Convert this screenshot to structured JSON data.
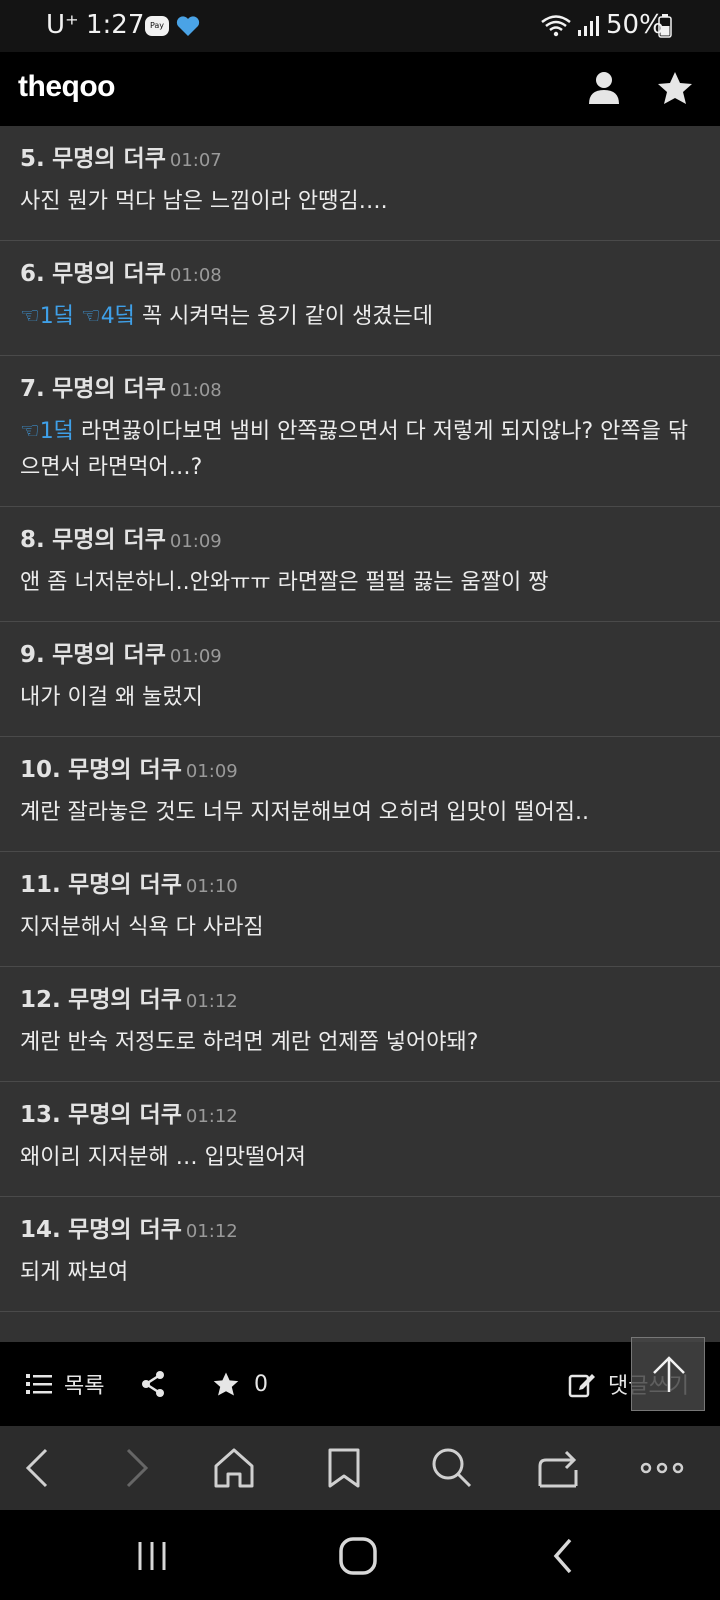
{
  "status_bar": {
    "carrier": "U⁺",
    "time": "1:27",
    "pay_badge": "Pay",
    "battery": "50%"
  },
  "app": {
    "title": "theqoo"
  },
  "comments": [
    {
      "num": "5.",
      "author": "무명의 더쿠",
      "time": "01:07",
      "mentions": [],
      "text": "사진 뭔가 먹다 남은 느낌이라 안땡김…."
    },
    {
      "num": "6.",
      "author": "무명의 더쿠",
      "time": "01:08",
      "mentions": [
        "☜1덬",
        "☜4덬"
      ],
      "text": "꼭 시켜먹는 용기 같이 생겼는데"
    },
    {
      "num": "7.",
      "author": "무명의 더쿠",
      "time": "01:08",
      "mentions": [
        "☜1덬"
      ],
      "text": "라면끓이다보면 냄비 안쪽끓으면서 다 저렇게 되지않나? 안쪽을 닦으면서 라면먹어…?"
    },
    {
      "num": "8.",
      "author": "무명의 더쿠",
      "time": "01:09",
      "mentions": [],
      "text": "앤 좀 너저분하니..안와ㅠㅠ 라면짤은 펄펄 끓는 움짤이 짱"
    },
    {
      "num": "9.",
      "author": "무명의 더쿠",
      "time": "01:09",
      "mentions": [],
      "text": "내가 이걸 왜 눌렀지"
    },
    {
      "num": "10.",
      "author": "무명의 더쿠",
      "time": "01:09",
      "mentions": [],
      "text": "계란 잘라놓은 것도 너무 지저분해보여 오히려 입맛이 떨어짐.."
    },
    {
      "num": "11.",
      "author": "무명의 더쿠",
      "time": "01:10",
      "mentions": [],
      "text": "지저분해서 식욕 다 사라짐"
    },
    {
      "num": "12.",
      "author": "무명의 더쿠",
      "time": "01:12",
      "mentions": [],
      "text": "계란 반숙 저정도로 하려면 계란 언제쯤 넣어야돼?"
    },
    {
      "num": "13.",
      "author": "무명의 더쿠",
      "time": "01:12",
      "mentions": [],
      "text": "왜이리 지저분해 … 입맛떨어져"
    },
    {
      "num": "14.",
      "author": "무명의 더쿠",
      "time": "01:12",
      "mentions": [],
      "text": "되게 짜보여"
    }
  ],
  "action_bar": {
    "list_label": "목록",
    "favorite_count": "0",
    "write_label": "댓글쓰기"
  },
  "colors": {
    "mention": "#3fa0e8",
    "background": "#333333"
  }
}
